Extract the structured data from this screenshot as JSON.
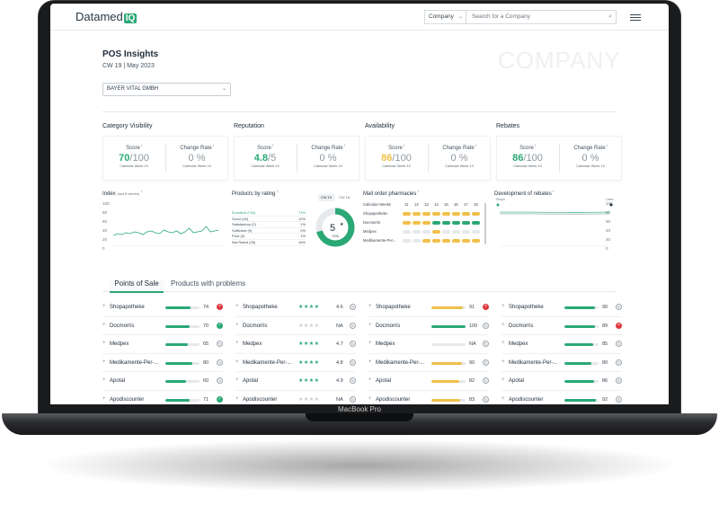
{
  "device": {
    "label": "MacBook Pro"
  },
  "header": {
    "logo_text": "Datamed",
    "logo_badge": "IQ",
    "company_select": "Company",
    "search_placeholder": "Search for a Company"
  },
  "page": {
    "title": "POS Insights",
    "subtitle": "CW 19 | May 2023",
    "watermark": "COMPANY",
    "company_dropdown": "BAYER VITAL GMBH"
  },
  "kpis": [
    {
      "title": "Category Visibility",
      "score_label": "Score",
      "score": "70",
      "score_max": "/100",
      "score_color": "#2aa876",
      "change_label": "Change Rate",
      "change": "0 %",
      "week_note": "Calendar Week 19"
    },
    {
      "title": "Reputation",
      "score_label": "Score",
      "score": "4.8",
      "score_max": "/5",
      "score_color": "#2aa876",
      "change_label": "Change Rate",
      "change": "0 %",
      "week_note": "Calendar Week 19"
    },
    {
      "title": "Availability",
      "score_label": "Score",
      "score": "86",
      "score_max": "/100",
      "score_color": "#f0c04a",
      "change_label": "Change Rate",
      "change": "0 %",
      "week_note": "Calendar Week 19"
    },
    {
      "title": "Rebates",
      "score_label": "Score",
      "score": "86",
      "score_max": "/100",
      "score_color": "#2aa876",
      "change_label": "Change Rate",
      "change": "0 %",
      "week_note": "Calendar Week 19"
    }
  ],
  "widgets": {
    "index": {
      "title": "Index",
      "title_note": "(last 8 weeks)",
      "y_ticks": [
        "100",
        "80",
        "60",
        "40",
        "20",
        "0"
      ]
    },
    "products_by_rating": {
      "title": "Products by rating",
      "cw_active": "CW 19",
      "cw_other": "CW 18",
      "rows": [
        {
          "label": "Excellent (*16)",
          "pct": "71%"
        },
        {
          "label": "Good (18)",
          "pct": "12%"
        },
        {
          "label": "Satisfactory (2)",
          "pct": "1%"
        },
        {
          "label": "Sufficient (0)",
          "pct": "0%"
        },
        {
          "label": "Poor (3)",
          "pct": "1%"
        },
        {
          "label": "Not Rated (25)",
          "pct": "16%"
        }
      ],
      "donut_value": "5",
      "donut_pct": "71%",
      "donut_fraction": 0.71
    },
    "mail_order": {
      "title": "Mail order pharmacies",
      "week_label": "Calendar Weeks",
      "weeks": [
        "11",
        "12",
        "13",
        "14",
        "15",
        "16",
        "17",
        "18"
      ],
      "rows": [
        {
          "name": "Shopapotheke",
          "colors": [
            "#f0c04a",
            "#f0c04a",
            "#f0c04a",
            "#f0c04a",
            "#f0c04a",
            "#f0c04a",
            "#f0c04a",
            "#f0c04a"
          ]
        },
        {
          "name": "Docmorris",
          "colors": [
            "#f0c04a",
            "#f0c04a",
            "#f0c04a",
            "#2aa876",
            "#2aa876",
            "#2aa876",
            "#2aa876",
            "#2aa876"
          ]
        },
        {
          "name": "Medpex",
          "colors": [
            "#e6e9ec",
            "#e6e9ec",
            "#e6e9ec",
            "#f0c04a",
            "#e6e9ec",
            "#e6e9ec",
            "#e6e9ec",
            "#e6e9ec"
          ]
        },
        {
          "name": "Medikamente-Per...",
          "colors": [
            "#e6e9ec",
            "#e6e9ec",
            "#f0c04a",
            "#f0c04a",
            "#f0c04a",
            "#f0c04a",
            "#f0c04a",
            "#f0c04a"
          ]
        }
      ]
    },
    "rebates": {
      "title": "Development of rebates",
      "y_ticks": [
        "100",
        "80",
        "60",
        "40",
        "20",
        "0"
      ],
      "legend_left": "Shops",
      "legend_right": "Lines"
    }
  },
  "tabs": {
    "active": "Points of Sale",
    "other": "Products with problems"
  },
  "pos_columns": [
    {
      "kind": "bar",
      "rows": [
        {
          "name": "Shopapotheke",
          "value": "74",
          "pct": 0.74,
          "color": "#2aa876",
          "status": "bad"
        },
        {
          "name": "Docmorris",
          "value": "70",
          "pct": 0.7,
          "color": "#2aa876",
          "status": "ok"
        },
        {
          "name": "Medpex",
          "value": "65",
          "pct": 0.65,
          "color": "#2aa876",
          "status": "refresh"
        },
        {
          "name": "Medikamente-Per-...",
          "value": "80",
          "pct": 0.8,
          "color": "#2aa876",
          "status": "refresh"
        },
        {
          "name": "Apotal",
          "value": "60",
          "pct": 0.6,
          "color": "#2aa876",
          "status": "refresh"
        },
        {
          "name": "Apodiscounter",
          "value": "71",
          "pct": 0.71,
          "color": "#2aa876",
          "status": "ok"
        }
      ]
    },
    {
      "kind": "stars",
      "rows": [
        {
          "name": "Shopapotheke",
          "value": "4.6",
          "stars": 4,
          "status": "refresh"
        },
        {
          "name": "Docmorris",
          "value": "NA",
          "stars": 0,
          "status": "refresh"
        },
        {
          "name": "Medpex",
          "value": "4.7",
          "stars": 4,
          "status": "refresh"
        },
        {
          "name": "Medikamente-Per-...",
          "value": "4.8",
          "stars": 4,
          "status": "refresh"
        },
        {
          "name": "Apotal",
          "value": "4.9",
          "stars": 4,
          "status": "refresh"
        },
        {
          "name": "Apodiscounter",
          "value": "NA",
          "stars": 0,
          "status": "refresh"
        }
      ]
    },
    {
      "kind": "bar",
      "rows": [
        {
          "name": "Shopapotheke",
          "value": "91",
          "pct": 0.91,
          "color": "#f0c04a",
          "status": "bad"
        },
        {
          "name": "Docmorris",
          "value": "100",
          "pct": 1.0,
          "color": "#2aa876",
          "status": "refresh"
        },
        {
          "name": "Medpex",
          "value": "NA",
          "pct": 0,
          "color": "#e6e9ec",
          "status": "refresh"
        },
        {
          "name": "Medikamente-Per-...",
          "value": "90",
          "pct": 0.9,
          "color": "#f0c04a",
          "status": "refresh"
        },
        {
          "name": "Apotal",
          "value": "82",
          "pct": 0.82,
          "color": "#f0c04a",
          "status": "refresh"
        },
        {
          "name": "Apodiscounter",
          "value": "83",
          "pct": 0.83,
          "color": "#f0c04a",
          "status": "refresh"
        }
      ]
    },
    {
      "kind": "bar",
      "rows": [
        {
          "name": "Shopapotheke",
          "value": "90",
          "pct": 0.9,
          "color": "#2aa876",
          "status": "refresh"
        },
        {
          "name": "Docmorris",
          "value": "89",
          "pct": 0.89,
          "color": "#2aa876",
          "status": "bad"
        },
        {
          "name": "Medpex",
          "value": "85",
          "pct": 0.85,
          "color": "#2aa876",
          "status": "refresh"
        },
        {
          "name": "Medikamente-Per-...",
          "value": "80",
          "pct": 0.8,
          "color": "#2aa876",
          "status": "refresh"
        },
        {
          "name": "Apotal",
          "value": "86",
          "pct": 0.86,
          "color": "#2aa876",
          "status": "refresh"
        },
        {
          "name": "Apodiscounter",
          "value": "92",
          "pct": 0.92,
          "color": "#2aa876",
          "status": "refresh"
        }
      ]
    }
  ]
}
